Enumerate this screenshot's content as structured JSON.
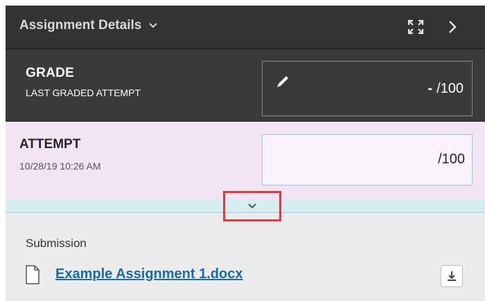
{
  "header": {
    "title": "Assignment Details",
    "title_chevron_icon": "chevron-down-icon",
    "expand_icon": "expand-icon",
    "next_icon": "chevron-right-icon"
  },
  "grade": {
    "label": "GRADE",
    "sublabel": "LAST GRADED ATTEMPT",
    "edit_icon": "pencil-icon",
    "value_dash": "-",
    "max": "/100"
  },
  "attempt": {
    "label": "ATTEMPT",
    "date": "10/28/19 10:26 AM",
    "max": "/100"
  },
  "expander": {
    "icon": "chevron-down-icon"
  },
  "submission": {
    "label": "Submission",
    "file_name": "Example Assignment 1.docx",
    "file_icon": "document-icon",
    "download_icon": "download-icon"
  },
  "colors": {
    "header_bg": "#333333",
    "grade_bg": "#3a3a3a",
    "attempt_bg": "#f2e4f3",
    "band_bg": "#d6eef2",
    "highlight": "#e5383b",
    "link": "#186aa8"
  }
}
